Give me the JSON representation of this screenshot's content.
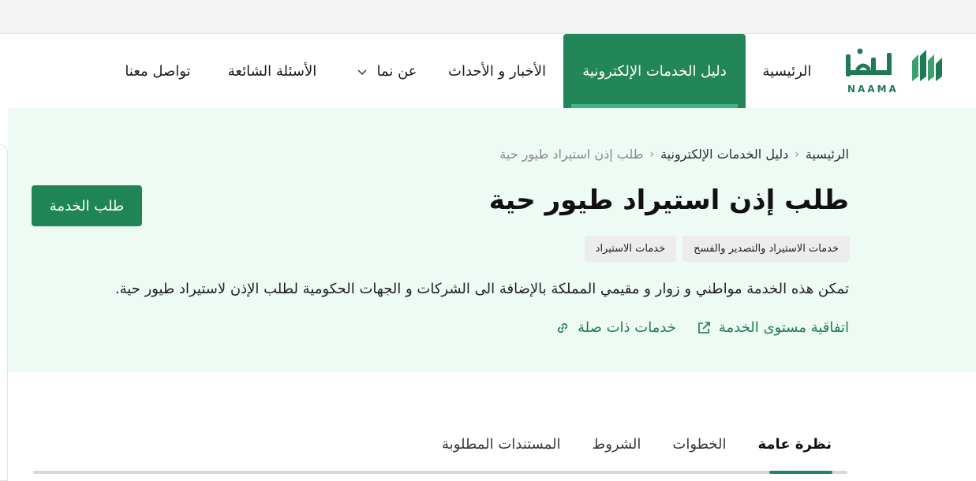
{
  "brand": {
    "logo_ar": "نما",
    "logo_en": "NAAMA",
    "primary_color": "#228658",
    "hero_bg": "#eefaf4"
  },
  "nav": {
    "home": "الرئيسية",
    "eservices_guide": "دليل الخدمات الإلكترونية",
    "news_events": "الأخبار و الأحداث",
    "about": "عن نما",
    "faq": "الأسئلة الشائعة",
    "contact": "تواصل معنا"
  },
  "breadcrumb": {
    "home": "الرئيسية",
    "guide": "دليل الخدمات الإلكترونية",
    "current": "طلب إذن استيراد طيور حية"
  },
  "service": {
    "title": "طلب إذن استيراد طيور حية",
    "request_button": "طلب الخدمة",
    "tags": [
      "خدمات الاستيراد والتصدير والفسح",
      "خدمات الاستيراد"
    ],
    "description": "تمكن هذه الخدمة مواطني و زوار و مقيمي المملكة بالإضافة الى الشركات و الجهات الحكومية لطلب الإذن لاستيراد طيور حية.",
    "sla_link": "اتفاقية مستوى الخدمة",
    "related_link": "خدمات ذات صلة"
  },
  "tabs": {
    "overview": "نظرة عامة",
    "steps": "الخطوات",
    "conditions": "الشروط",
    "documents": "المستندات المطلوبة"
  }
}
